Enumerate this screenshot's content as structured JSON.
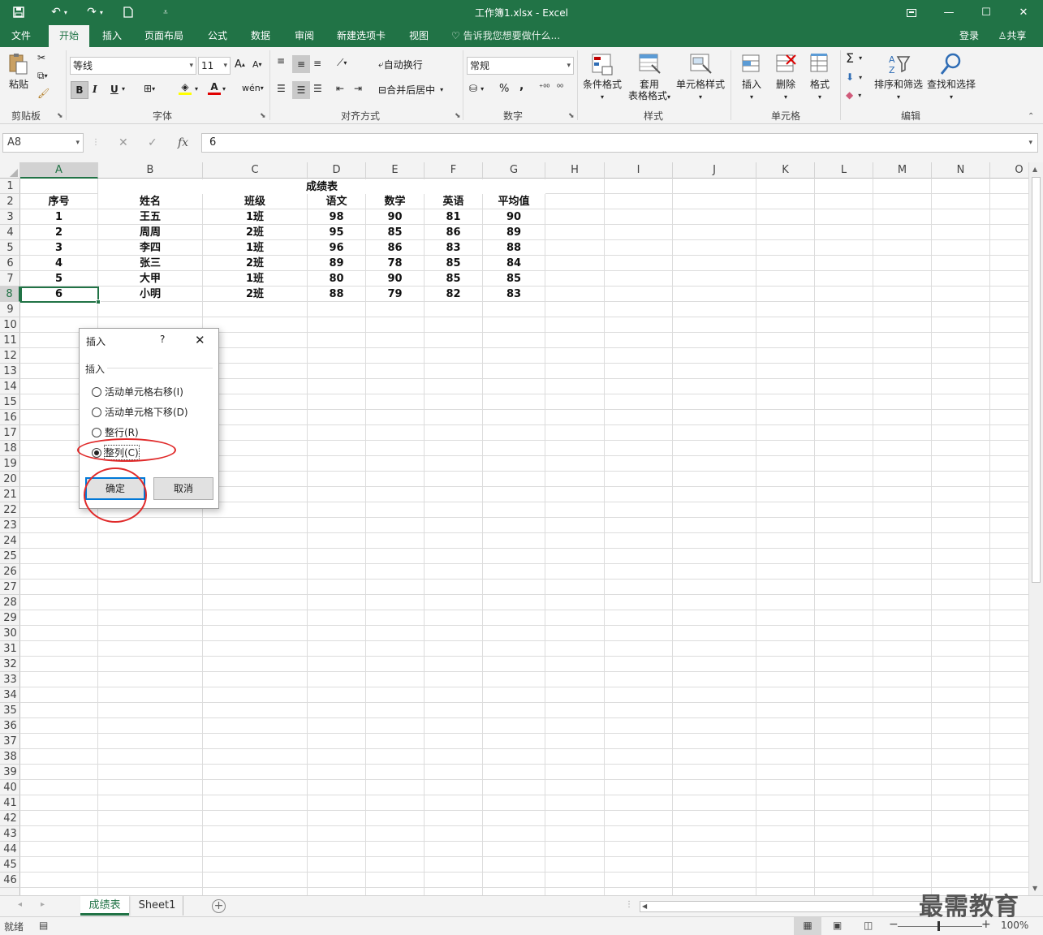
{
  "app": {
    "title": "工作簿1.xlsx - Excel",
    "login": "登录",
    "share": "共享"
  },
  "tabs": [
    "文件",
    "开始",
    "插入",
    "页面布局",
    "公式",
    "数据",
    "审阅",
    "新建选项卡",
    "视图"
  ],
  "tellme": "告诉我您想要做什么...",
  "ribbon": {
    "clipboard": {
      "label": "剪贴板",
      "paste": "粘贴"
    },
    "font": {
      "label": "字体",
      "name": "等线",
      "size": "11",
      "bold": "B",
      "italic": "I",
      "underline": "U"
    },
    "alignment": {
      "label": "对齐方式",
      "wrap": "自动换行",
      "merge": "合并后居中"
    },
    "number": {
      "label": "数字",
      "format": "常规",
      "percent": "%",
      "comma": ","
    },
    "styles": {
      "label": "样式",
      "cond": "条件格式",
      "table_line1": "套用",
      "table_line2": "表格格式",
      "cellstyle": "单元格样式"
    },
    "cells": {
      "label": "单元格",
      "insert": "插入",
      "delete": "删除",
      "format": "格式"
    },
    "editing": {
      "label": "编辑",
      "sort": "排序和筛选",
      "find": "查找和选择",
      "sum": "Σ"
    }
  },
  "formula_bar": {
    "name_box": "A8",
    "cancel": "✕",
    "enter": "✓",
    "fx": "fx",
    "value": "6"
  },
  "columns": [
    "A",
    "B",
    "C",
    "D",
    "E",
    "F",
    "G",
    "H",
    "I",
    "J",
    "K",
    "L",
    "M",
    "N",
    "O"
  ],
  "rows": [
    "1",
    "2",
    "3",
    "4",
    "5",
    "6",
    "7",
    "8",
    "9",
    "10",
    "11",
    "12",
    "13",
    "14",
    "15",
    "16",
    "17",
    "18",
    "19",
    "20",
    "21",
    "22",
    "23",
    "24",
    "25",
    "26",
    "27",
    "28",
    "29",
    "30",
    "31",
    "32",
    "33",
    "34",
    "35",
    "36",
    "37",
    "38",
    "39",
    "40",
    "41",
    "42",
    "43",
    "44",
    "45",
    "46"
  ],
  "sheet": {
    "title": "成绩表",
    "headers": [
      "序号",
      "姓名",
      "班级",
      "语文",
      "数学",
      "英语",
      "平均值"
    ],
    "data": [
      [
        "1",
        "王五",
        "1班",
        "98",
        "90",
        "81",
        "90"
      ],
      [
        "2",
        "周周",
        "2班",
        "95",
        "85",
        "86",
        "89"
      ],
      [
        "3",
        "李四",
        "1班",
        "96",
        "86",
        "83",
        "88"
      ],
      [
        "4",
        "张三",
        "2班",
        "89",
        "78",
        "85",
        "84"
      ],
      [
        "5",
        "大甲",
        "1班",
        "80",
        "90",
        "85",
        "85"
      ],
      [
        "6",
        "小明",
        "2班",
        "88",
        "79",
        "82",
        "83"
      ]
    ],
    "active_cell": "A8"
  },
  "dialog": {
    "title": "插入",
    "help": "?",
    "close": "✕",
    "group": "插入",
    "options": [
      {
        "label": "活动单元格右移(I)",
        "checked": false
      },
      {
        "label": "活动单元格下移(D)",
        "checked": false
      },
      {
        "label": "整行(R)",
        "checked": false
      },
      {
        "label": "整列(C)",
        "checked": true
      }
    ],
    "ok": "确定",
    "cancel": "取消"
  },
  "sheet_tabs": [
    "成绩表",
    "Sheet1"
  ],
  "status": {
    "ready": "就绪",
    "zoom": "100%"
  },
  "watermark": "最需教育",
  "colors": {
    "accent": "#217346",
    "annotation": "#e02a2a",
    "dialog_focus": "#0078d7"
  }
}
